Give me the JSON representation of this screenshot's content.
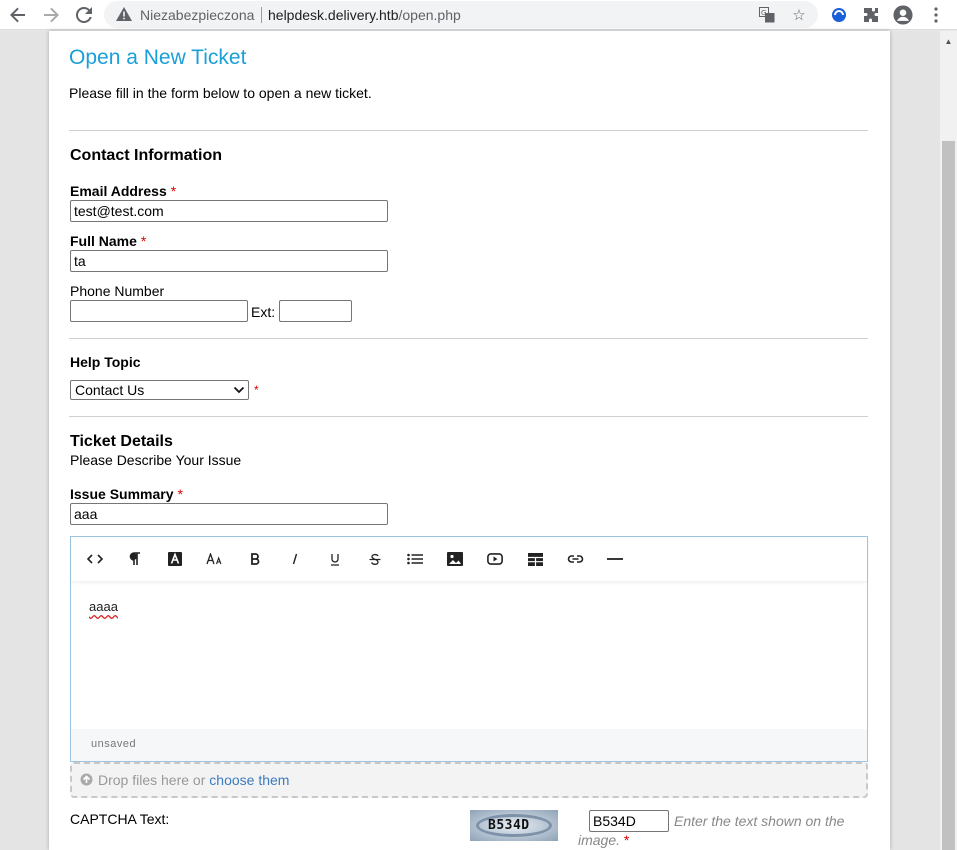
{
  "browser": {
    "security_label": "Niezabezpieczona",
    "url_host": "helpdesk.delivery.htb",
    "url_path": "/open.php"
  },
  "page": {
    "title": "Open a New Ticket",
    "intro": "Please fill in the form below to open a new ticket."
  },
  "contact": {
    "heading": "Contact Information",
    "email_label": "Email Address",
    "email_value": "test@test.com",
    "name_label": "Full Name",
    "name_value": "ta",
    "phone_label": "Phone Number",
    "phone_value": "",
    "ext_label": "Ext:",
    "ext_value": "",
    "required_mark": "*"
  },
  "help_topic": {
    "label": "Help Topic",
    "selected": "Contact Us",
    "required_mark": "*"
  },
  "ticket": {
    "heading": "Ticket Details",
    "subheading": "Please Describe Your Issue",
    "summary_label": "Issue Summary",
    "summary_value": "aaa",
    "body_text": "aaaa",
    "status": "unsaved",
    "required_mark": "*"
  },
  "toolbar": {
    "items": [
      "code-view",
      "paragraph",
      "text-color",
      "font-size",
      "bold",
      "italic",
      "underline",
      "strikethrough",
      "list",
      "image",
      "video",
      "table",
      "link",
      "horizontal-rule"
    ]
  },
  "attachments": {
    "prefix": "Drop files here or",
    "link": "choose them"
  },
  "captcha": {
    "label": "CAPTCHA Text:",
    "code": "B534D",
    "input_value": "B534D",
    "hint": "Enter the text shown on the image.",
    "required_mark": "*"
  }
}
